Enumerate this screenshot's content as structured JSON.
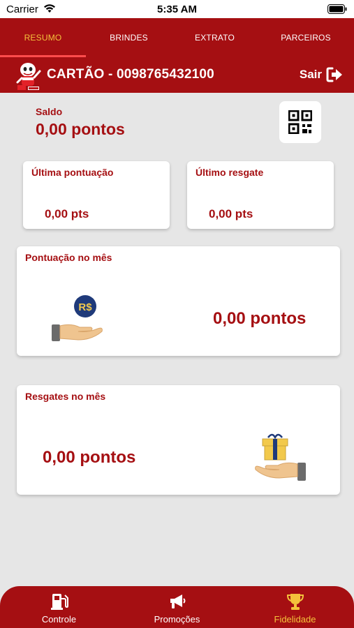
{
  "status_bar": {
    "carrier": "Carrier",
    "time": "5:35 AM"
  },
  "tabs": [
    {
      "label": "RESUMO",
      "active": true
    },
    {
      "label": "BRINDES",
      "active": false
    },
    {
      "label": "EXTRATO",
      "active": false
    },
    {
      "label": "PARCEIROS",
      "active": false
    }
  ],
  "header": {
    "card_label": "CARTÃO - 0098765432100",
    "logout_label": "Sair"
  },
  "balance": {
    "label": "Saldo",
    "value": "0,00 pontos"
  },
  "last_points": {
    "title": "Última pontuação",
    "value": "0,00 pts"
  },
  "last_redeem": {
    "title": "Último resgate",
    "value": "0,00 pts"
  },
  "month_points": {
    "title": "Pontuação no mês",
    "value": "0,00 pontos",
    "badge": "R$"
  },
  "month_redeems": {
    "title": "Resgates no mês",
    "value": "0,00 pontos"
  },
  "bottom_nav": [
    {
      "label": "Controle",
      "icon": "fuel-pump-icon",
      "active": false
    },
    {
      "label": "Promoções",
      "icon": "megaphone-icon",
      "active": false
    },
    {
      "label": "Fidelidade",
      "icon": "trophy-icon",
      "active": true
    }
  ],
  "colors": {
    "brand_red": "#a50f12",
    "accent_yellow": "#f4c23b",
    "background": "#e6e6e6"
  }
}
